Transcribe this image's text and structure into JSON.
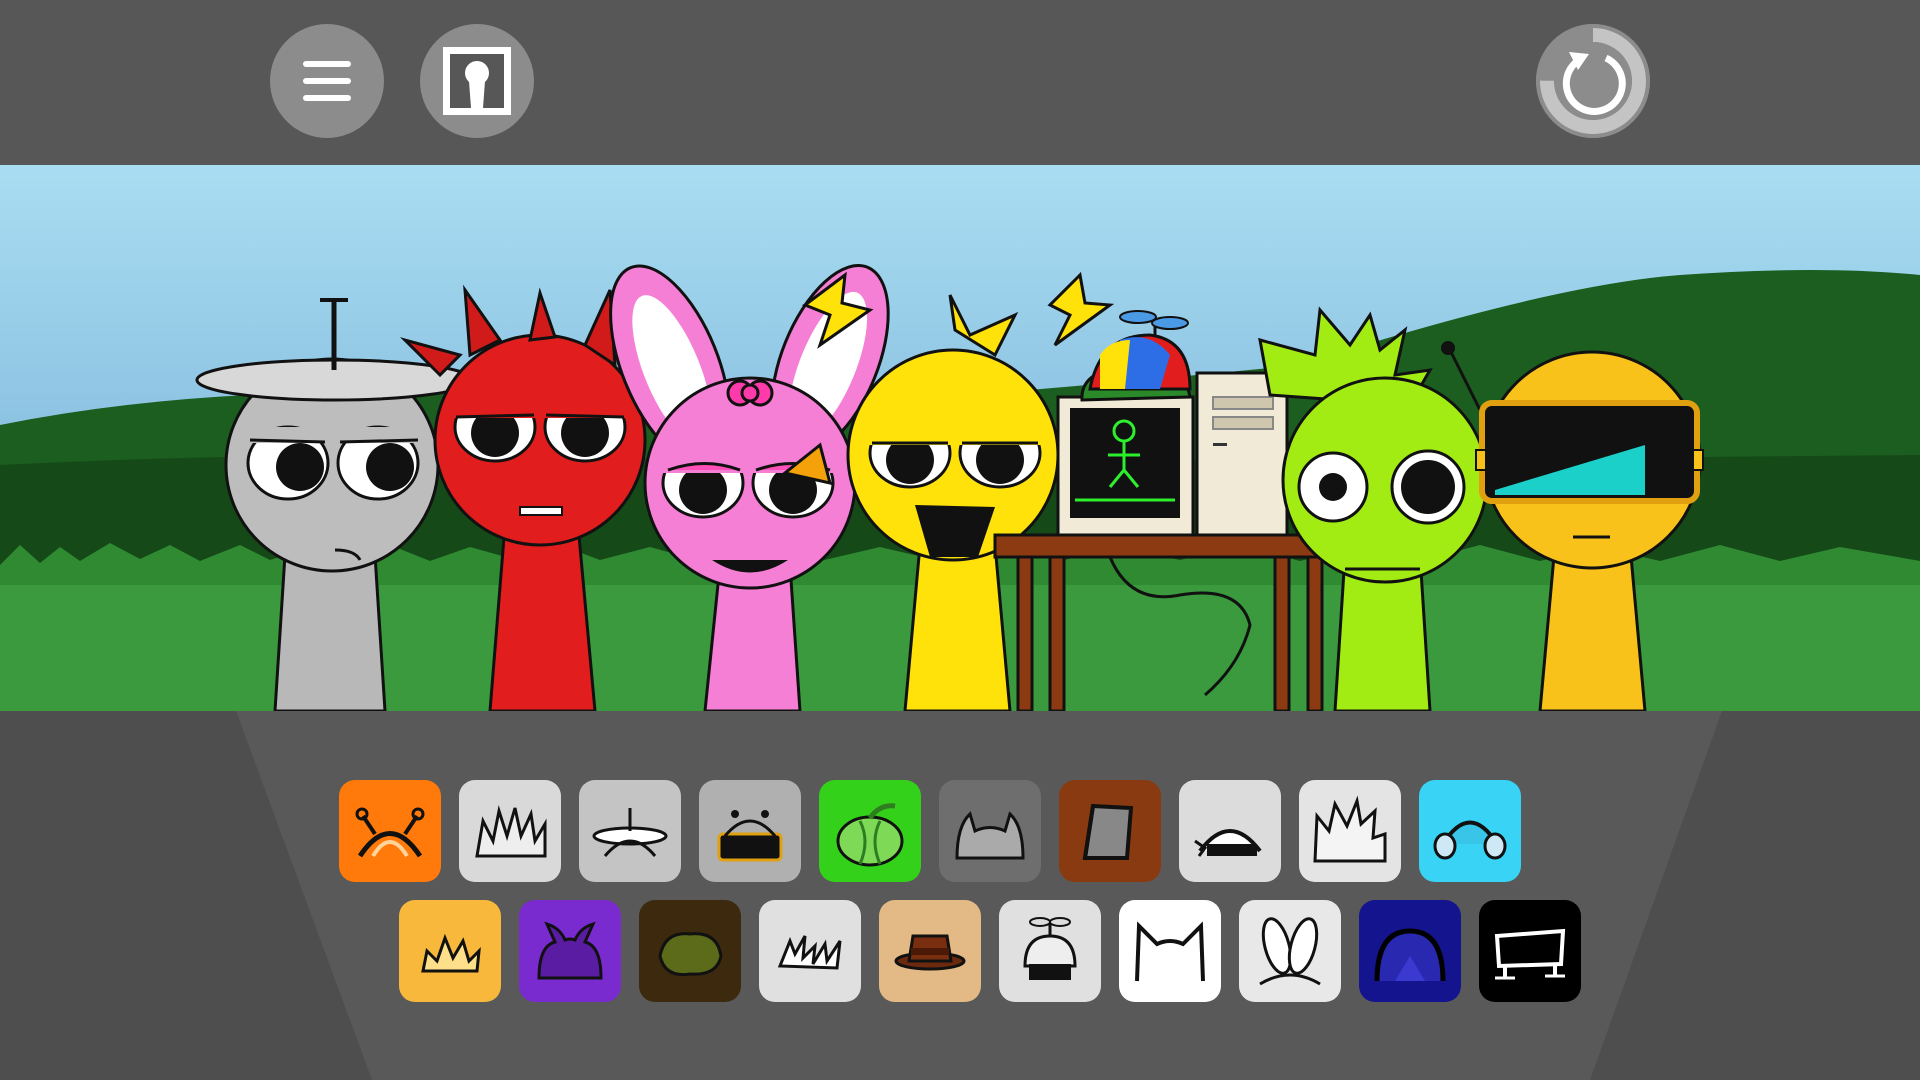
{
  "toolbar": {
    "menu_icon": "hamburger-menu-icon",
    "photo_icon": "portrait-frame-icon",
    "reset_icon": "reset-arrow-icon",
    "reset_progress": 0.75
  },
  "stage": {
    "characters": [
      {
        "name": "gray-antenna-dish",
        "color": "#bdbdbd"
      },
      {
        "name": "red-devil",
        "color": "#e21d1d"
      },
      {
        "name": "pink-bunny",
        "color": "#f47fd4"
      },
      {
        "name": "yellow-spiky",
        "color": "#ffe20a"
      },
      {
        "name": "computer-desk",
        "color": "#8b3a12"
      },
      {
        "name": "lime-spiky",
        "color": "#a3ec13"
      },
      {
        "name": "orange-visor",
        "color": "#f8c21a"
      }
    ]
  },
  "palette": {
    "row1": [
      {
        "id": "orange-antenna",
        "bg": "#ff7a0a"
      },
      {
        "id": "white-spiky-hair",
        "bg": "#d9d9d9"
      },
      {
        "id": "gray-dish",
        "bg": "#c4c4c4"
      },
      {
        "id": "gray-visor",
        "bg": "#b0b0b0"
      },
      {
        "id": "green-pumpkin",
        "bg": "#34d11a"
      },
      {
        "id": "gray-cat-ears",
        "bg": "#6e6e6e"
      },
      {
        "id": "brown-bucket",
        "bg": "#8a3a10"
      },
      {
        "id": "white-headband",
        "bg": "#dcdcdc"
      },
      {
        "id": "white-spikes",
        "bg": "#e4e4e4"
      },
      {
        "id": "cyan-headphones",
        "bg": "#38d3f5"
      }
    ],
    "row2": [
      {
        "id": "sun-crown",
        "bg": "#f8b83c"
      },
      {
        "id": "purple-horns",
        "bg": "#7a2bd0"
      },
      {
        "id": "dark-moss",
        "bg": "#3d2a0e"
      },
      {
        "id": "white-lightning",
        "bg": "#e0e0e0"
      },
      {
        "id": "tan-hat",
        "bg": "#e3b985"
      },
      {
        "id": "propeller-cap",
        "bg": "#e0e0e0"
      },
      {
        "id": "white-cat-ears",
        "bg": "#ffffff"
      },
      {
        "id": "bunny-ears",
        "bg": "#e8e8e8"
      },
      {
        "id": "navy-dome",
        "bg": "#14148f"
      },
      {
        "id": "black-frame",
        "bg": "#000000"
      }
    ]
  }
}
